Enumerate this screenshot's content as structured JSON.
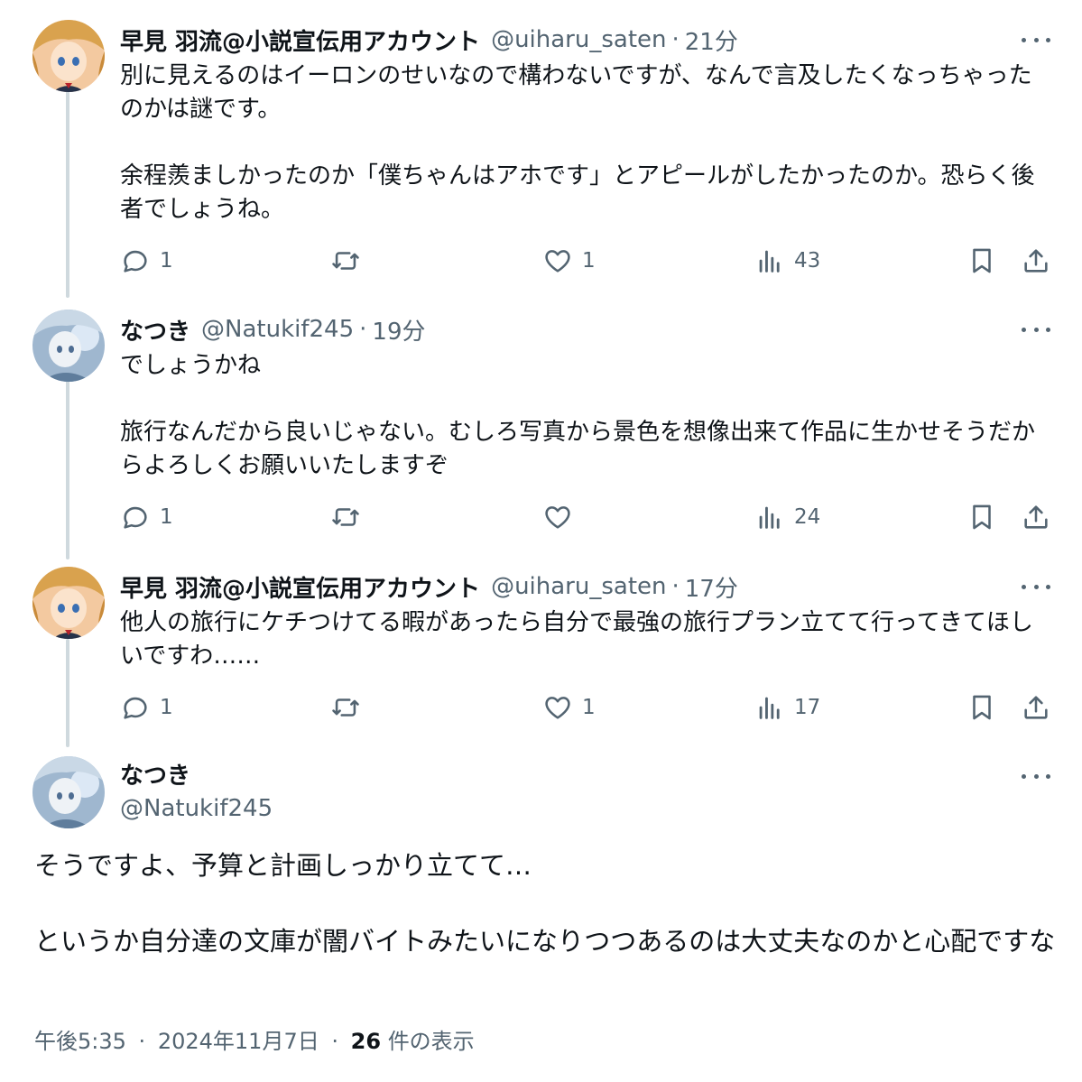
{
  "colors": {
    "text_primary": "#0f1419",
    "text_secondary": "#536471",
    "thread_line": "#cfd9de",
    "background": "#ffffff"
  },
  "icons": {
    "reply": "speech-bubble-icon",
    "retweet": "retweet-arrows-icon",
    "like": "heart-icon",
    "views": "bar-chart-icon",
    "bookmark": "bookmark-icon",
    "share": "upload-share-icon",
    "more": "three-dots-icon"
  },
  "tweets": [
    {
      "name": "早見 羽流@小説宣伝用アカウント",
      "handle": "@uiharu_saten",
      "separator": "·",
      "time": "21分",
      "paragraphs": [
        "別に見えるのはイーロンのせいなので構わないですが、なんで言及したくなっちゃったのかは謎です。",
        "余程羨ましかったのか「僕ちゃんはアホです」とアピールがしたかったのか。恐らく後者でしょうね。"
      ],
      "replies": "1",
      "retweets": "",
      "likes": "1",
      "views": "43"
    },
    {
      "name": "なつき",
      "handle": "@Natukif245",
      "separator": "·",
      "time": "19分",
      "paragraphs": [
        "でしょうかね",
        "旅行なんだから良いじゃない。むしろ写真から景色を想像出来て作品に生かせそうだからよろしくお願いいたしますぞ"
      ],
      "replies": "1",
      "retweets": "",
      "likes": "",
      "views": "24"
    },
    {
      "name": "早見 羽流@小説宣伝用アカウント",
      "handle": "@uiharu_saten",
      "separator": "·",
      "time": "17分",
      "paragraphs": [
        "他人の旅行にケチつけてる暇があったら自分で最強の旅行プラン立てて行ってきてほしいですわ……"
      ],
      "replies": "1",
      "retweets": "",
      "likes": "1",
      "views": "17"
    }
  ],
  "detail": {
    "name": "なつき",
    "handle": "@Natukif245",
    "paragraphs": [
      "そうですよ、予算と計画しっかり立てて…",
      "というか自分達の文庫が闇バイトみたいになりつつあるのは大丈夫なのかと心配ですな"
    ],
    "time": "午後5:35",
    "separator": "·",
    "date": "2024年11月7日",
    "separator2": "·",
    "views_count": "26",
    "views_label": "件の表示"
  }
}
